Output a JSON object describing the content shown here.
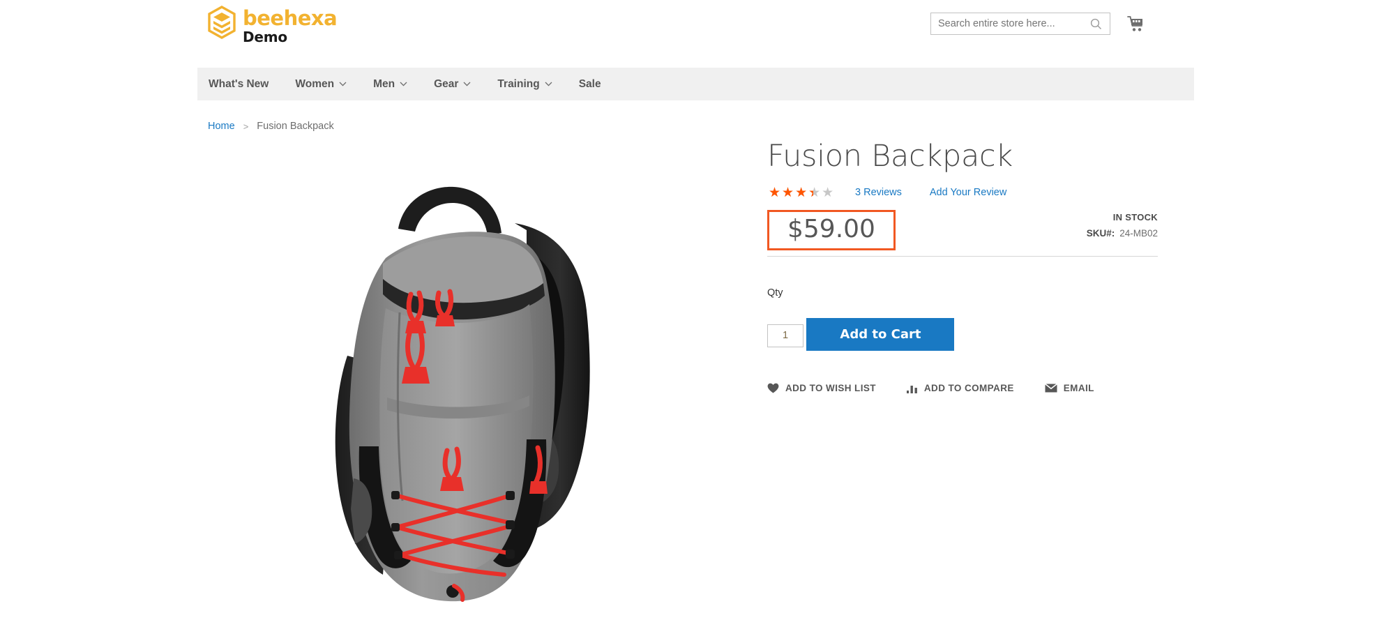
{
  "header": {
    "logo": {
      "icon": "hexagon-layers-icon",
      "word": "beehexa",
      "sub": "Demo",
      "brand_color": "#f2b230",
      "sub_color": "#1a1a1a"
    },
    "search": {
      "icon": "search-icon",
      "placeholder": "Search entire store here...",
      "value": ""
    },
    "cart": {
      "icon": "shopping-cart-icon"
    }
  },
  "nav": {
    "background": "#f0f0f0",
    "items": [
      {
        "label": "What's New",
        "has_dropdown": false
      },
      {
        "label": "Women",
        "has_dropdown": true
      },
      {
        "label": "Men",
        "has_dropdown": true
      },
      {
        "label": "Gear",
        "has_dropdown": true
      },
      {
        "label": "Training",
        "has_dropdown": true
      },
      {
        "label": "Sale",
        "has_dropdown": false
      }
    ]
  },
  "breadcrumb": {
    "home": "Home",
    "separator": ">",
    "current": "Fusion Backpack"
  },
  "product": {
    "title": "Fusion Backpack",
    "image_alt": "Fusion Backpack grey and black backpack with red bungee cords",
    "rating": {
      "value": 3.5,
      "max": 5,
      "percent": 70,
      "stars_full": "★★★★★",
      "filled_color": "#ff5501",
      "empty_color": "#c7c7c7",
      "reviews_label": "3  Reviews",
      "add_review_label": "Add Your Review"
    },
    "price": {
      "value": "$59.00",
      "highlight_color": "#f15822"
    },
    "availability": "IN STOCK",
    "sku": {
      "key": "SKU#:",
      "value": "24-MB02"
    },
    "qty": {
      "label": "Qty",
      "value": "1"
    },
    "add_to_cart_label": "Add to Cart",
    "actions": [
      {
        "label": "ADD TO WISH LIST",
        "icon": "heart-icon"
      },
      {
        "label": "ADD TO COMPARE",
        "icon": "bar-chart-icon"
      },
      {
        "label": "EMAIL",
        "icon": "envelope-icon"
      }
    ]
  },
  "colors": {
    "accent_blue": "#1979c3",
    "brand_orange": "#f15822",
    "star_orange": "#ff5501",
    "logo_yellow": "#f2b230",
    "nav_bg": "#f0f0f0",
    "text_gray": "#575757"
  }
}
